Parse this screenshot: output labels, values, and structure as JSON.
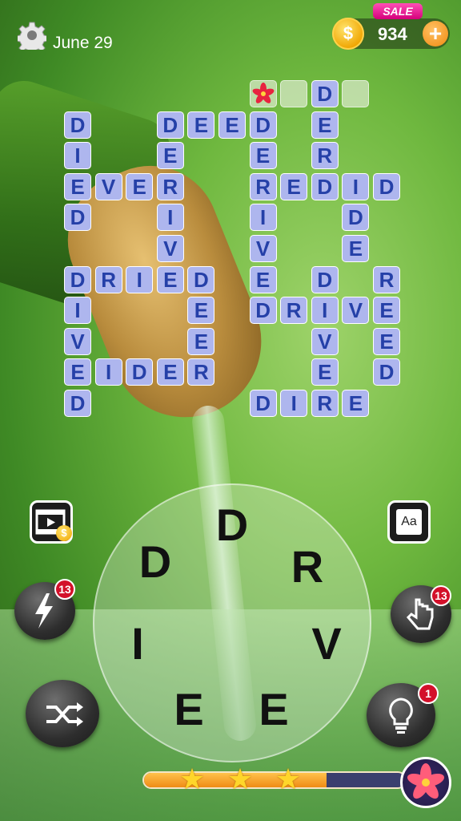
{
  "header": {
    "date": "June 29",
    "coins": "934",
    "sale_label": "SALE",
    "coin_symbol": "$",
    "plus_label": "+"
  },
  "grid": {
    "cells": [
      {
        "r": 0,
        "c": 8,
        "ch": "D"
      },
      {
        "r": 1,
        "c": 0,
        "ch": "D"
      },
      {
        "r": 1,
        "c": 3,
        "ch": "D"
      },
      {
        "r": 1,
        "c": 4,
        "ch": "E"
      },
      {
        "r": 1,
        "c": 5,
        "ch": "E"
      },
      {
        "r": 1,
        "c": 6,
        "ch": "D"
      },
      {
        "r": 1,
        "c": 8,
        "ch": "E"
      },
      {
        "r": 2,
        "c": 0,
        "ch": "I"
      },
      {
        "r": 2,
        "c": 3,
        "ch": "E"
      },
      {
        "r": 2,
        "c": 6,
        "ch": "E"
      },
      {
        "r": 2,
        "c": 8,
        "ch": "R"
      },
      {
        "r": 3,
        "c": 0,
        "ch": "E"
      },
      {
        "r": 3,
        "c": 1,
        "ch": "V"
      },
      {
        "r": 3,
        "c": 2,
        "ch": "E"
      },
      {
        "r": 3,
        "c": 3,
        "ch": "R"
      },
      {
        "r": 3,
        "c": 6,
        "ch": "R"
      },
      {
        "r": 3,
        "c": 7,
        "ch": "E"
      },
      {
        "r": 3,
        "c": 8,
        "ch": "D"
      },
      {
        "r": 3,
        "c": 9,
        "ch": "I"
      },
      {
        "r": 3,
        "c": 10,
        "ch": "D"
      },
      {
        "r": 4,
        "c": 0,
        "ch": "D"
      },
      {
        "r": 4,
        "c": 3,
        "ch": "I"
      },
      {
        "r": 4,
        "c": 6,
        "ch": "I"
      },
      {
        "r": 4,
        "c": 9,
        "ch": "D"
      },
      {
        "r": 5,
        "c": 3,
        "ch": "V"
      },
      {
        "r": 5,
        "c": 6,
        "ch": "V"
      },
      {
        "r": 5,
        "c": 9,
        "ch": "E"
      },
      {
        "r": 6,
        "c": 0,
        "ch": "D"
      },
      {
        "r": 6,
        "c": 1,
        "ch": "R"
      },
      {
        "r": 6,
        "c": 2,
        "ch": "I"
      },
      {
        "r": 6,
        "c": 3,
        "ch": "E"
      },
      {
        "r": 6,
        "c": 4,
        "ch": "D"
      },
      {
        "r": 6,
        "c": 6,
        "ch": "E"
      },
      {
        "r": 6,
        "c": 8,
        "ch": "D"
      },
      {
        "r": 6,
        "c": 10,
        "ch": "R"
      },
      {
        "r": 7,
        "c": 0,
        "ch": "I"
      },
      {
        "r": 7,
        "c": 4,
        "ch": "E"
      },
      {
        "r": 7,
        "c": 6,
        "ch": "D"
      },
      {
        "r": 7,
        "c": 7,
        "ch": "R"
      },
      {
        "r": 7,
        "c": 8,
        "ch": "I"
      },
      {
        "r": 7,
        "c": 9,
        "ch": "V"
      },
      {
        "r": 7,
        "c": 10,
        "ch": "E"
      },
      {
        "r": 8,
        "c": 0,
        "ch": "V"
      },
      {
        "r": 8,
        "c": 4,
        "ch": "E"
      },
      {
        "r": 8,
        "c": 8,
        "ch": "V"
      },
      {
        "r": 8,
        "c": 10,
        "ch": "E"
      },
      {
        "r": 9,
        "c": 0,
        "ch": "E"
      },
      {
        "r": 9,
        "c": 1,
        "ch": "I"
      },
      {
        "r": 9,
        "c": 2,
        "ch": "D"
      },
      {
        "r": 9,
        "c": 3,
        "ch": "E"
      },
      {
        "r": 9,
        "c": 4,
        "ch": "R"
      },
      {
        "r": 9,
        "c": 8,
        "ch": "E"
      },
      {
        "r": 9,
        "c": 10,
        "ch": "D"
      },
      {
        "r": 10,
        "c": 0,
        "ch": "D"
      },
      {
        "r": 10,
        "c": 6,
        "ch": "D"
      },
      {
        "r": 10,
        "c": 7,
        "ch": "I"
      },
      {
        "r": 10,
        "c": 8,
        "ch": "R"
      },
      {
        "r": 10,
        "c": 9,
        "ch": "E"
      }
    ],
    "empty_cells": [
      {
        "r": 0,
        "c": 7
      },
      {
        "r": 0,
        "c": 9
      }
    ],
    "bonus_cell": {
      "r": 0,
      "c": 6,
      "icon": "flower-icon"
    }
  },
  "wheel": {
    "letters": [
      "D",
      "R",
      "V",
      "E",
      "E",
      "I",
      "D"
    ]
  },
  "buttons": {
    "video_coin_badge": "$",
    "font_label": "Aa",
    "lightning_count": "13",
    "finger_count": "13",
    "hint_count": "1"
  },
  "progress": {
    "fill_fraction": 0.7,
    "stars_earned": 3
  },
  "colors": {
    "tile_fill": "#aeb6ee",
    "tile_text": "#2540a8",
    "badge_red": "#d3102a",
    "progress_fill": "#ef8b15"
  }
}
